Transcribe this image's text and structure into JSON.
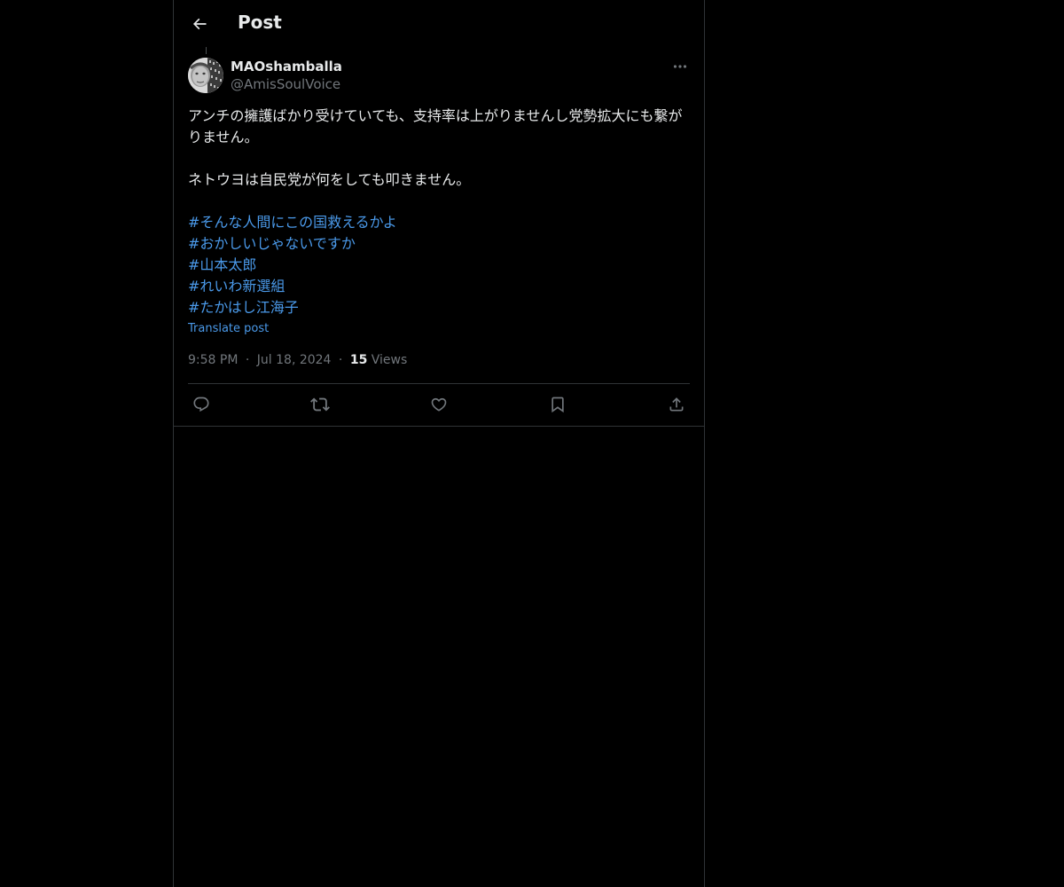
{
  "header": {
    "title": "Post"
  },
  "author": {
    "name": "MAOshamballa",
    "handle": "@AmisSoulVoice"
  },
  "post": {
    "paragraph1": "アンチの擁護ばかり受けていても、支持率は上がりませんし党勢拡大にも繋がりません。",
    "paragraph2": "ネトウヨは自民党が何をしても叩きません。",
    "hashtags": [
      "#そんな人間にこの国救えるかよ",
      "#おかしいじゃないですか",
      "#山本太郎",
      "#れいわ新選組",
      "#たかはし江海子"
    ],
    "translate_label": "Translate post"
  },
  "meta": {
    "time": "9:58 PM",
    "separator": "·",
    "date": "Jul 18, 2024",
    "views_count": "15",
    "views_label": "Views"
  },
  "colors": {
    "background": "#000000",
    "text": "#e7e9ea",
    "muted": "#71767b",
    "link": "#4a99e9",
    "border": "#2f3336"
  },
  "icons": {
    "back": "arrow-left-icon",
    "more": "more-horizontal-icon",
    "reply": "reply-icon",
    "repost": "repost-icon",
    "like": "heart-icon",
    "bookmark": "bookmark-icon",
    "share": "share-icon"
  }
}
